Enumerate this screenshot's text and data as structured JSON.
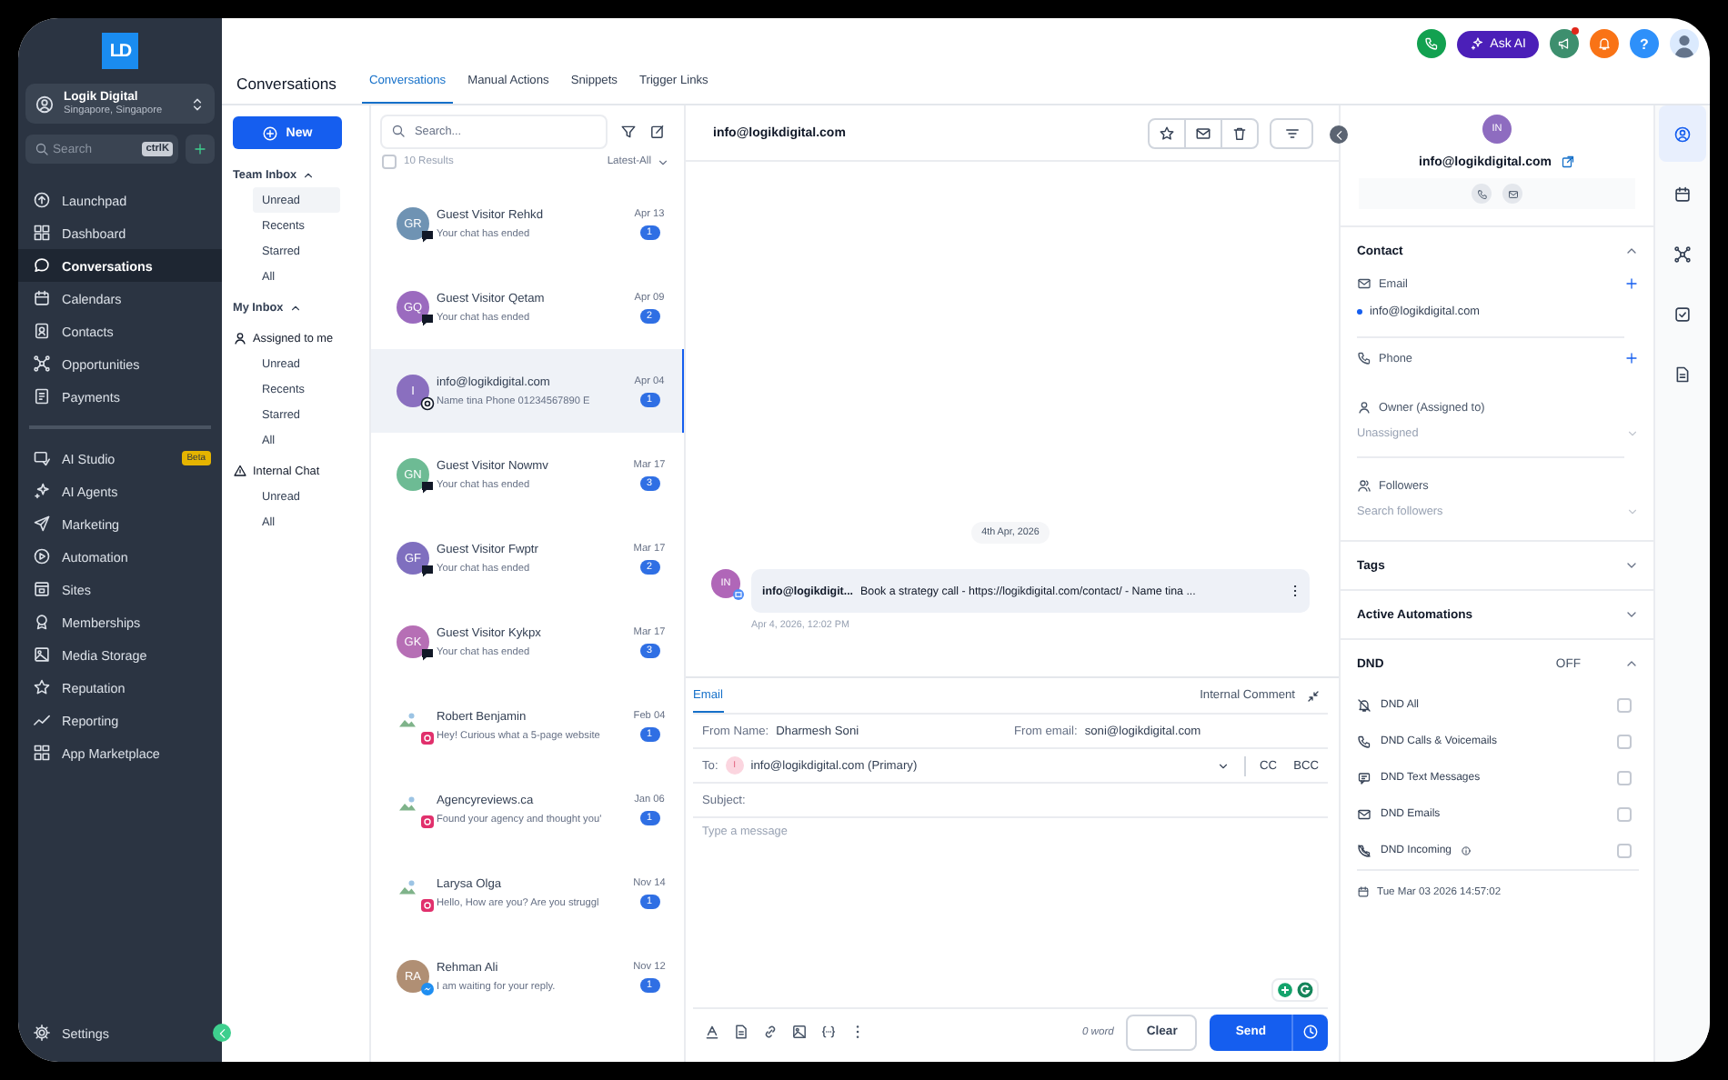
{
  "sidebar": {
    "logo": "LD",
    "account": {
      "name": "Logik Digital",
      "location": "Singapore, Singapore"
    },
    "search": {
      "placeholder": "Search",
      "shortcut": "ctrlK"
    },
    "nav_groups": [
      {
        "items": [
          {
            "label": "Launchpad",
            "selected": false
          },
          {
            "label": "Dashboard",
            "selected": false
          },
          {
            "label": "Conversations",
            "selected": true
          },
          {
            "label": "Calendars",
            "selected": false
          },
          {
            "label": "Contacts",
            "selected": false
          },
          {
            "label": "Opportunities",
            "selected": false
          },
          {
            "label": "Payments",
            "selected": false
          }
        ]
      },
      {
        "items": [
          {
            "label": "AI Studio",
            "selected": false,
            "badge": "Beta"
          },
          {
            "label": "AI Agents",
            "selected": false
          },
          {
            "label": "Marketing",
            "selected": false
          },
          {
            "label": "Automation",
            "selected": false
          },
          {
            "label": "Sites",
            "selected": false
          },
          {
            "label": "Memberships",
            "selected": false
          },
          {
            "label": "Media Storage",
            "selected": false
          },
          {
            "label": "Reputation",
            "selected": false
          },
          {
            "label": "Reporting",
            "selected": false
          },
          {
            "label": "App Marketplace",
            "selected": false
          }
        ]
      }
    ],
    "settings": "Settings"
  },
  "header": {
    "title": "Conversations",
    "tabs": [
      {
        "label": "Conversations",
        "selected": true
      },
      {
        "label": "Manual Actions",
        "selected": false
      },
      {
        "label": "Snippets",
        "selected": false
      },
      {
        "label": "Trigger Links",
        "selected": false
      }
    ],
    "ask_ai": "Ask AI",
    "help": "?"
  },
  "filters": {
    "new_button": "New",
    "sections": [
      {
        "kind": "group",
        "title": "Team Inbox",
        "expanded": true,
        "items": [
          {
            "label": "Unread",
            "selected": true
          },
          {
            "label": "Recents",
            "selected": false
          },
          {
            "label": "Starred",
            "selected": false
          },
          {
            "label": "All",
            "selected": false
          }
        ]
      },
      {
        "kind": "group",
        "title": "My Inbox",
        "expanded": true
      },
      {
        "kind": "assigned",
        "title": "Assigned to me",
        "items": [
          {
            "label": "Unread",
            "selected": false
          },
          {
            "label": "Recents",
            "selected": false
          },
          {
            "label": "Starred",
            "selected": false
          },
          {
            "label": "All",
            "selected": false
          }
        ]
      },
      {
        "kind": "internal",
        "title": "Internal Chat",
        "items": [
          {
            "label": "Unread",
            "selected": false
          },
          {
            "label": "All",
            "selected": false
          }
        ]
      }
    ]
  },
  "conversations": {
    "search_placeholder": "Search...",
    "select_all": {
      "checked": false
    },
    "results": "10 Results",
    "sort": "Latest-All",
    "items": [
      {
        "name": "Guest Visitor Rehkd",
        "initials": "GR",
        "color": "#6f93b3",
        "kind": "chat",
        "preview": "Your chat has ended",
        "date": "Apr 13",
        "unread": "1",
        "selected": false
      },
      {
        "name": "Guest Visitor Qetam",
        "initials": "GQ",
        "color": "#9b6bbf",
        "kind": "chat",
        "preview": "Your chat has ended",
        "date": "Apr 09",
        "unread": "2",
        "selected": false
      },
      {
        "name": "info@logikdigital.com",
        "initials": "I",
        "color": "#8a6fbf",
        "kind": "email",
        "preview": "Name tina Phone 01234567890 E",
        "date": "Apr 04",
        "unread": "1",
        "selected": true
      },
      {
        "name": "Guest Visitor Nowmv",
        "initials": "GN",
        "color": "#6dbb94",
        "kind": "chat",
        "preview": "Your chat has ended",
        "date": "Mar 17",
        "unread": "3",
        "selected": false
      },
      {
        "name": "Guest Visitor Fwptr",
        "initials": "GF",
        "color": "#7f6fbf",
        "kind": "chat",
        "preview": "Your chat has ended",
        "date": "Mar 17",
        "unread": "2",
        "selected": false
      },
      {
        "name": "Guest Visitor Kykpx",
        "initials": "GK",
        "color": "#b66fb5",
        "kind": "chat",
        "preview": "Your chat has ended",
        "date": "Mar 17",
        "unread": "3",
        "selected": false
      },
      {
        "name": "Robert Benjamin",
        "kind": "instagram",
        "preview": "Hey! Curious what a 5-page website",
        "date": "Feb 04",
        "unread": "1",
        "selected": false
      },
      {
        "name": "Agencyreviews.ca",
        "kind": "instagram",
        "preview": "Found your agency and thought you'",
        "date": "Jan 06",
        "unread": "1",
        "selected": false
      },
      {
        "name": "Larysa Olga",
        "kind": "instagram",
        "preview": "Hello, How are you? Are you struggl",
        "date": "Nov 14",
        "unread": "1",
        "selected": false
      },
      {
        "name": "Rehman Ali",
        "initials": "RA",
        "color": "#b08f74",
        "kind": "messenger",
        "preview": "I am waiting for your reply.",
        "date": "Nov 12",
        "unread": "1",
        "selected": false
      }
    ]
  },
  "chat": {
    "title": "info@logikdigital.com",
    "date_divider": "4th Apr, 2026",
    "messages": [
      {
        "avatar": "IN",
        "sender": "info@logikdigit...",
        "body": "Book a strategy call - https://logikdigital.com/contact/ - Name tina ...",
        "time": "Apr 4, 2026, 12:02 PM"
      }
    ],
    "composer": {
      "tabs": [
        {
          "label": "Email",
          "selected": true
        },
        {
          "label": "Internal Comment",
          "selected": false
        }
      ],
      "from_name_label": "From Name:",
      "from_name": "Dharmesh Soni",
      "from_email_label": "From email:",
      "from_email": "soni@logikdigital.com",
      "to_label": "To:",
      "to_initial": "I",
      "to": "info@logikdigital.com (Primary)",
      "cc": "CC",
      "bcc": "BCC",
      "subject_label": "Subject:",
      "message_placeholder": "Type a message",
      "word_count": "0 word",
      "clear": "Clear",
      "send": "Send"
    }
  },
  "contact_panel": {
    "avatar": "IN",
    "email": "info@logikdigital.com",
    "sections": [
      {
        "kind": "contact",
        "title": "Contact",
        "expanded": true,
        "email_label": "Email",
        "email": "info@logikdigital.com",
        "phone_label": "Phone",
        "owner_label": "Owner (Assigned to)",
        "owner_placeholder": "Unassigned",
        "followers_label": "Followers",
        "followers_placeholder": "Search followers"
      },
      {
        "title": "Tags",
        "expanded": false
      },
      {
        "title": "Active Automations",
        "expanded": false
      },
      {
        "kind": "dnd",
        "title": "DND",
        "status": "OFF",
        "expanded": true,
        "items": [
          {
            "label": "DND All",
            "checked": false
          },
          {
            "label": "DND Calls & Voicemails",
            "checked": false
          },
          {
            "label": "DND Text Messages",
            "checked": false
          },
          {
            "label": "DND Emails",
            "checked": false
          },
          {
            "label": "DND Incoming",
            "checked": false
          }
        ],
        "date": "Tue Mar 03 2026 14:57:02"
      }
    ]
  },
  "rail": [
    {
      "selected": true
    },
    {
      "selected": false
    },
    {
      "selected": false
    },
    {
      "selected": false
    },
    {
      "selected": false
    }
  ]
}
